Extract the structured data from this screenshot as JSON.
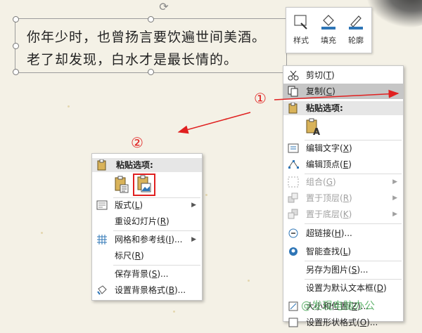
{
  "poem": {
    "line1": "你年少时，也曾扬言要饮遍世间美酒。",
    "line2": "老了却发现，白水才是最长情的。"
  },
  "mini_toolbar": {
    "style_label": "样式",
    "fill_label": "填充",
    "outline_label": "轮廓"
  },
  "annotations": {
    "marker1": "①",
    "marker2": "②",
    "watermark": "@发现电脑办公"
  },
  "context_menu_right": {
    "cut": {
      "label": "剪切",
      "key": "T"
    },
    "copy": {
      "label": "复制",
      "key": "C"
    },
    "paste_options": "粘贴选项:",
    "edit_text": {
      "label": "编辑文字",
      "key": "X"
    },
    "edit_points": {
      "label": "编辑顶点",
      "key": "E"
    },
    "group": {
      "label": "组合",
      "key": "G"
    },
    "bring_front": {
      "label": "置于顶层",
      "key": "R"
    },
    "send_back": {
      "label": "置于底层",
      "key": "K"
    },
    "hyperlink": {
      "label": "超链接",
      "key": "H",
      "suffix": "..."
    },
    "smart_lookup": {
      "label": "智能查找",
      "key": "L"
    },
    "save_as_picture": {
      "label": "另存为图片",
      "key": "S",
      "suffix": "..."
    },
    "set_default_textbox": {
      "label": "设置为默认文本框",
      "key": "D"
    },
    "size_position": {
      "label": "大小和位置",
      "key": "Z",
      "suffix": "..."
    },
    "format_shape": {
      "label": "设置形状格式",
      "key": "O",
      "suffix": "..."
    }
  },
  "context_menu_left": {
    "paste_options": "粘贴选项:",
    "layout": {
      "label": "版式",
      "key": "L"
    },
    "reset_slide": {
      "label": "重设幻灯片",
      "key": "R"
    },
    "grid_guides": {
      "label": "网格和参考线",
      "key": "I",
      "suffix": "..."
    },
    "ruler": {
      "label": "标尺",
      "key": "R"
    },
    "save_background": {
      "label": "保存背景",
      "key": "S",
      "suffix": "..."
    },
    "format_background": {
      "label": "设置背景格式",
      "key": "B",
      "suffix": "..."
    }
  },
  "colors": {
    "accent_red": "#e02020",
    "menu_highlight": "#c6c6c6",
    "fill_blue": "#2e75b6"
  }
}
